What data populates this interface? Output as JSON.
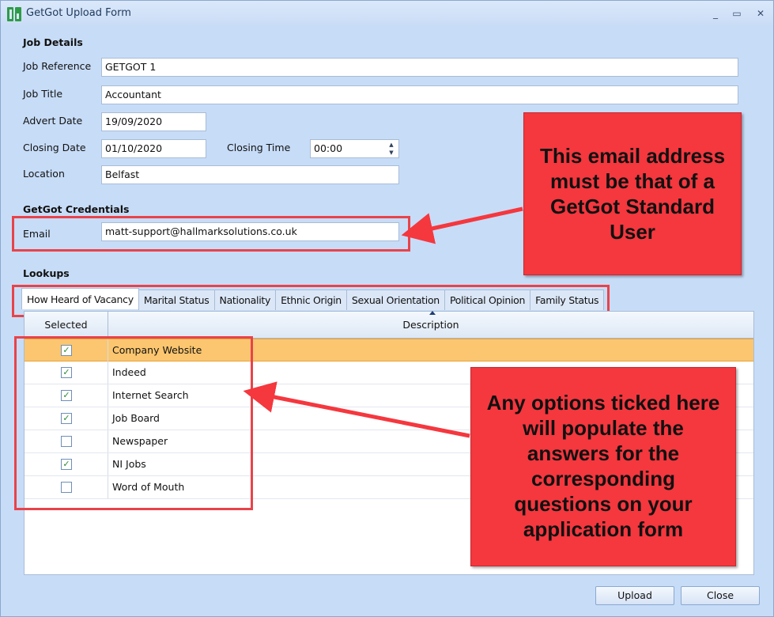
{
  "window": {
    "title": "GetGot Upload Form",
    "controls": {
      "minimize": "_",
      "maximize": "▭",
      "close": "✕"
    }
  },
  "job_details": {
    "section_title": "Job Details",
    "job_reference": {
      "label": "Job Reference",
      "value": "GETGOT 1"
    },
    "job_title": {
      "label": "Job Title",
      "value": "Accountant"
    },
    "advert_date": {
      "label": "Advert Date",
      "value": "19/09/2020"
    },
    "closing_date": {
      "label": "Closing Date",
      "value": "01/10/2020"
    },
    "closing_time": {
      "label": "Closing Time",
      "value": "00:00"
    },
    "location": {
      "label": "Location",
      "value": "Belfast"
    }
  },
  "credentials": {
    "section_title": "GetGot Credentials",
    "email": {
      "label": "Email",
      "value": "matt-support@hallmarksolutions.co.uk"
    }
  },
  "lookups": {
    "section_title": "Lookups",
    "tabs": [
      "How Heard of Vacancy",
      "Marital Status",
      "Nationality",
      "Ethnic Origin",
      "Sexual Orientation",
      "Political Opinion",
      "Family Status"
    ],
    "active_tab": "How Heard of Vacancy",
    "columns": {
      "selected": "Selected",
      "description": "Description"
    },
    "rows": [
      {
        "description": "Company Website",
        "checked": true,
        "selected": true
      },
      {
        "description": "Indeed",
        "checked": true,
        "selected": false
      },
      {
        "description": "Internet Search",
        "checked": true,
        "selected": false
      },
      {
        "description": "Job Board",
        "checked": true,
        "selected": false
      },
      {
        "description": "Newspaper",
        "checked": false,
        "selected": false
      },
      {
        "description": "NI Jobs",
        "checked": true,
        "selected": false
      },
      {
        "description": "Word of Mouth",
        "checked": false,
        "selected": false
      }
    ]
  },
  "buttons": {
    "upload": "Upload",
    "close": "Close"
  },
  "callouts": {
    "email_note": [
      "This email address",
      "must be that of a",
      "GetGot Standard",
      "User"
    ],
    "options_note": [
      "Any options ticked here",
      "will populate the",
      "answers for the",
      "corresponding",
      "questions on your",
      "application form"
    ]
  },
  "colors": {
    "window_bg": "#c7dcf7",
    "callout_red": "#f5373e",
    "selected_row": "#fbc66f",
    "highlight_border": "#e8434a"
  }
}
